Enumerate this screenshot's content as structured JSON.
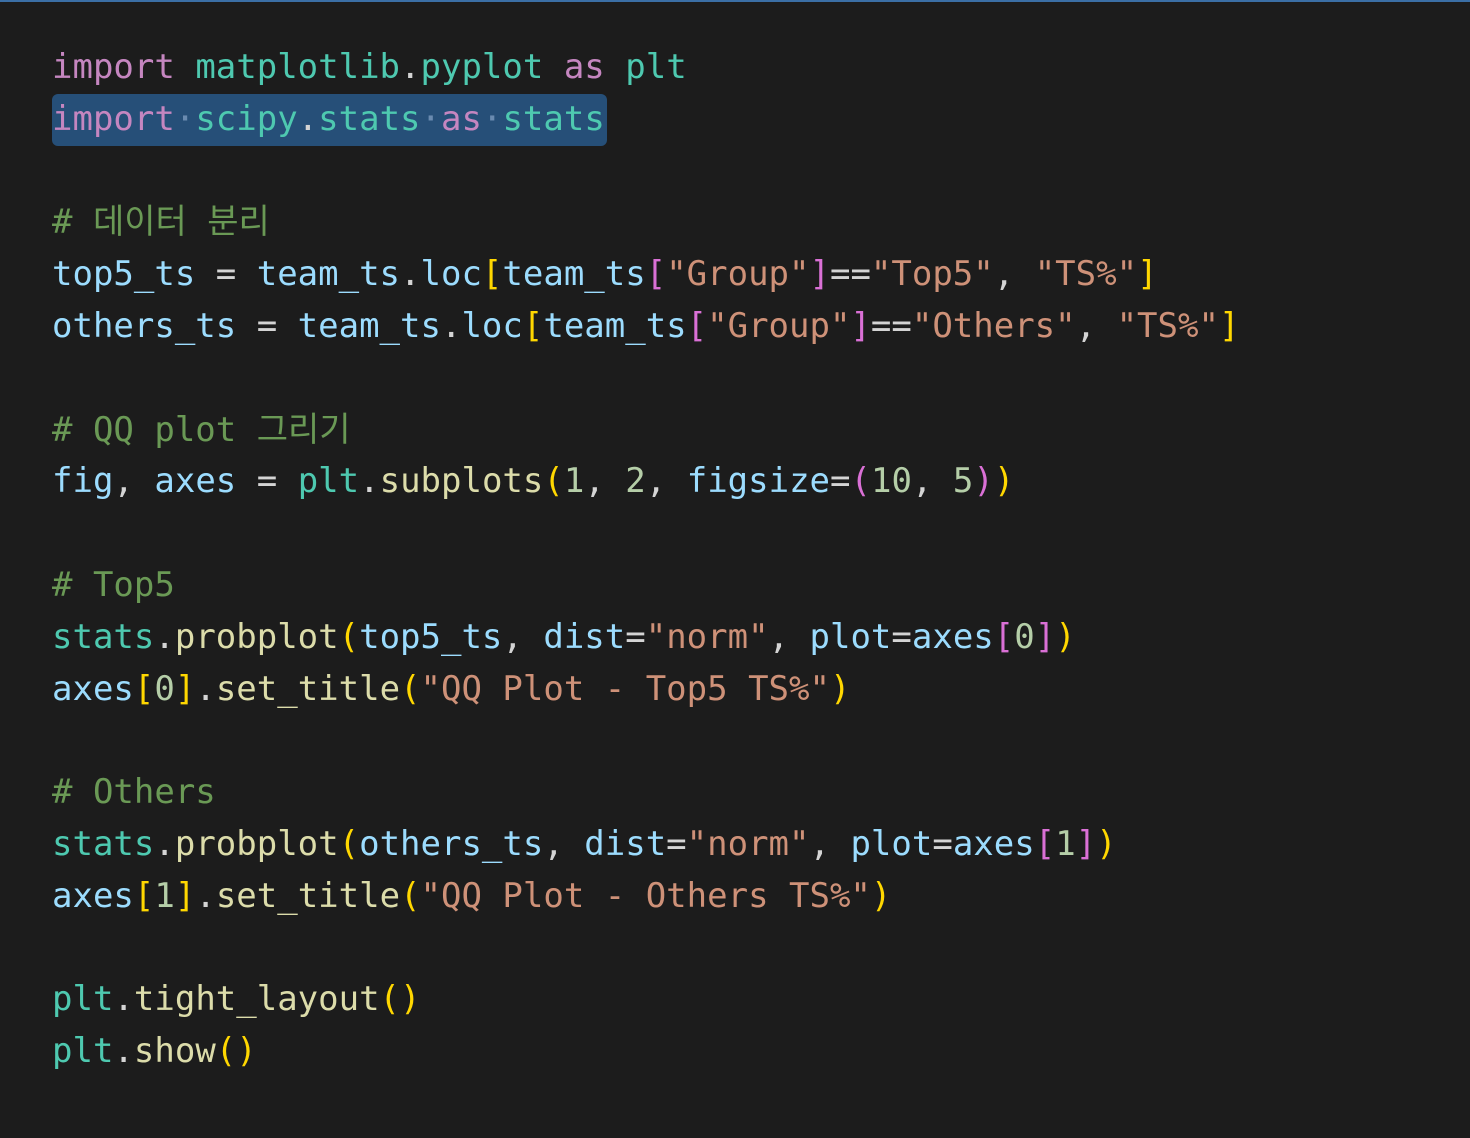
{
  "theme": {
    "background": "#1c1c1c",
    "selection": "#264f78",
    "colors": {
      "keyword": "#c586c0",
      "module": "#4ec9b0",
      "variable": "#9cdcfe",
      "function": "#dcdcaa",
      "string": "#ce9178",
      "number": "#b5cea8",
      "comment": "#6a9955",
      "punct": "#d4d4d4",
      "bracket1": "#ffd700",
      "bracket2": "#da70d6",
      "bracket3": "#179fff"
    }
  },
  "editor": {
    "lines": [
      [
        [
          "import",
          "keyword"
        ],
        [
          " ",
          "punct"
        ],
        [
          "matplotlib",
          "module"
        ],
        [
          ".",
          "punct"
        ],
        [
          "pyplot",
          "module"
        ],
        [
          " ",
          "punct"
        ],
        [
          "as",
          "keyword"
        ],
        [
          " ",
          "punct"
        ],
        [
          "plt",
          "module"
        ]
      ],
      [
        [
          "import",
          "keyword",
          "sel"
        ],
        [
          "·",
          "ws",
          "sel"
        ],
        [
          "scipy",
          "module",
          "sel"
        ],
        [
          ".",
          "punct",
          "sel"
        ],
        [
          "stats",
          "module",
          "sel"
        ],
        [
          "·",
          "ws",
          "sel"
        ],
        [
          "as",
          "keyword",
          "sel"
        ],
        [
          "·",
          "ws",
          "sel"
        ],
        [
          "stats",
          "module",
          "sel"
        ]
      ],
      [],
      [
        [
          "# 데이터 분리",
          "comment"
        ]
      ],
      [
        [
          "top5_ts",
          "variable"
        ],
        [
          " = ",
          "punct"
        ],
        [
          "team_ts",
          "variable"
        ],
        [
          ".",
          "punct"
        ],
        [
          "loc",
          "variable"
        ],
        [
          "[",
          "bracket1"
        ],
        [
          "team_ts",
          "variable"
        ],
        [
          "[",
          "bracket2"
        ],
        [
          "\"Group\"",
          "string"
        ],
        [
          "]",
          "bracket2"
        ],
        [
          "==",
          "punct"
        ],
        [
          "\"Top5\"",
          "string"
        ],
        [
          ", ",
          "punct"
        ],
        [
          "\"TS%\"",
          "string"
        ],
        [
          "]",
          "bracket1"
        ]
      ],
      [
        [
          "others_ts",
          "variable"
        ],
        [
          " = ",
          "punct"
        ],
        [
          "team_ts",
          "variable"
        ],
        [
          ".",
          "punct"
        ],
        [
          "loc",
          "variable"
        ],
        [
          "[",
          "bracket1"
        ],
        [
          "team_ts",
          "variable"
        ],
        [
          "[",
          "bracket2"
        ],
        [
          "\"Group\"",
          "string"
        ],
        [
          "]",
          "bracket2"
        ],
        [
          "==",
          "punct"
        ],
        [
          "\"Others\"",
          "string"
        ],
        [
          ", ",
          "punct"
        ],
        [
          "\"TS%\"",
          "string"
        ],
        [
          "]",
          "bracket1"
        ]
      ],
      [],
      [
        [
          "# QQ plot 그리기",
          "comment"
        ]
      ],
      [
        [
          "fig",
          "variable"
        ],
        [
          ", ",
          "punct"
        ],
        [
          "axes",
          "variable"
        ],
        [
          " = ",
          "punct"
        ],
        [
          "plt",
          "module"
        ],
        [
          ".",
          "punct"
        ],
        [
          "subplots",
          "function"
        ],
        [
          "(",
          "bracket1"
        ],
        [
          "1",
          "number"
        ],
        [
          ", ",
          "punct"
        ],
        [
          "2",
          "number"
        ],
        [
          ", ",
          "punct"
        ],
        [
          "figsize",
          "variable"
        ],
        [
          "=",
          "punct"
        ],
        [
          "(",
          "bracket2"
        ],
        [
          "10",
          "number"
        ],
        [
          ", ",
          "punct"
        ],
        [
          "5",
          "number"
        ],
        [
          ")",
          "bracket2"
        ],
        [
          ")",
          "bracket1"
        ]
      ],
      [],
      [
        [
          "# Top5",
          "comment"
        ]
      ],
      [
        [
          "stats",
          "module"
        ],
        [
          ".",
          "punct"
        ],
        [
          "probplot",
          "function"
        ],
        [
          "(",
          "bracket1"
        ],
        [
          "top5_ts",
          "variable"
        ],
        [
          ", ",
          "punct"
        ],
        [
          "dist",
          "variable"
        ],
        [
          "=",
          "punct"
        ],
        [
          "\"norm\"",
          "string"
        ],
        [
          ", ",
          "punct"
        ],
        [
          "plot",
          "variable"
        ],
        [
          "=",
          "punct"
        ],
        [
          "axes",
          "variable"
        ],
        [
          "[",
          "bracket2"
        ],
        [
          "0",
          "number"
        ],
        [
          "]",
          "bracket2"
        ],
        [
          ")",
          "bracket1"
        ]
      ],
      [
        [
          "axes",
          "variable"
        ],
        [
          "[",
          "bracket1"
        ],
        [
          "0",
          "number"
        ],
        [
          "]",
          "bracket1"
        ],
        [
          ".",
          "punct"
        ],
        [
          "set_title",
          "function"
        ],
        [
          "(",
          "bracket1"
        ],
        [
          "\"QQ Plot - Top5 TS%\"",
          "string"
        ],
        [
          ")",
          "bracket1"
        ]
      ],
      [],
      [
        [
          "# Others",
          "comment"
        ]
      ],
      [
        [
          "stats",
          "module"
        ],
        [
          ".",
          "punct"
        ],
        [
          "probplot",
          "function"
        ],
        [
          "(",
          "bracket1"
        ],
        [
          "others_ts",
          "variable"
        ],
        [
          ", ",
          "punct"
        ],
        [
          "dist",
          "variable"
        ],
        [
          "=",
          "punct"
        ],
        [
          "\"norm\"",
          "string"
        ],
        [
          ", ",
          "punct"
        ],
        [
          "plot",
          "variable"
        ],
        [
          "=",
          "punct"
        ],
        [
          "axes",
          "variable"
        ],
        [
          "[",
          "bracket2"
        ],
        [
          "1",
          "number"
        ],
        [
          "]",
          "bracket2"
        ],
        [
          ")",
          "bracket1"
        ]
      ],
      [
        [
          "axes",
          "variable"
        ],
        [
          "[",
          "bracket1"
        ],
        [
          "1",
          "number"
        ],
        [
          "]",
          "bracket1"
        ],
        [
          ".",
          "punct"
        ],
        [
          "set_title",
          "function"
        ],
        [
          "(",
          "bracket1"
        ],
        [
          "\"QQ Plot - Others TS%\"",
          "string"
        ],
        [
          ")",
          "bracket1"
        ]
      ],
      [],
      [
        [
          "plt",
          "module"
        ],
        [
          ".",
          "punct"
        ],
        [
          "tight_layout",
          "function"
        ],
        [
          "(",
          "bracket1"
        ],
        [
          ")",
          "bracket1"
        ]
      ],
      [
        [
          "plt",
          "module"
        ],
        [
          ".",
          "punct"
        ],
        [
          "show",
          "function"
        ],
        [
          "(",
          "bracket1"
        ],
        [
          ")",
          "bracket1"
        ]
      ]
    ]
  }
}
